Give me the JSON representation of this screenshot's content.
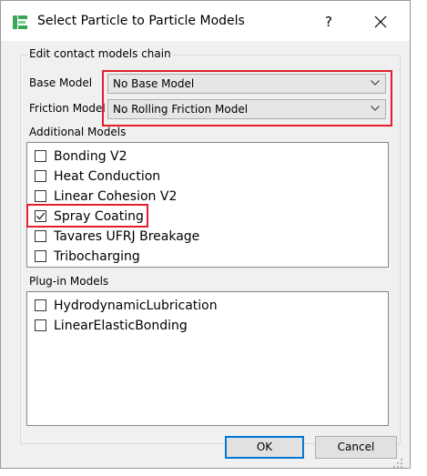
{
  "window": {
    "title": "Select Particle to Particle Models",
    "help_label": "?",
    "close_label": "✕"
  },
  "group": {
    "title": "Edit contact models chain"
  },
  "base_model": {
    "label": "Base Model",
    "value": "No Base Model"
  },
  "friction_model": {
    "label": "Friction Model",
    "value": "No Rolling Friction Model"
  },
  "additional_models": {
    "label": "Additional Models",
    "items": [
      {
        "label": "Bonding V2",
        "checked": false
      },
      {
        "label": "Heat Conduction",
        "checked": false
      },
      {
        "label": "Linear Cohesion V2",
        "checked": false
      },
      {
        "label": "Spray Coating",
        "checked": true
      },
      {
        "label": "Tavares UFRJ Breakage",
        "checked": false
      },
      {
        "label": "Tribocharging",
        "checked": false
      }
    ]
  },
  "plugin_models": {
    "label": "Plug-in Models",
    "items": [
      {
        "label": "HydrodynamicLubrication",
        "checked": false
      },
      {
        "label": "LinearElasticBonding",
        "checked": false
      }
    ]
  },
  "buttons": {
    "ok": "OK",
    "cancel": "Cancel"
  },
  "colors": {
    "highlight": "#e3202a",
    "accent": "#0078d7",
    "icon": "#3aa757"
  }
}
